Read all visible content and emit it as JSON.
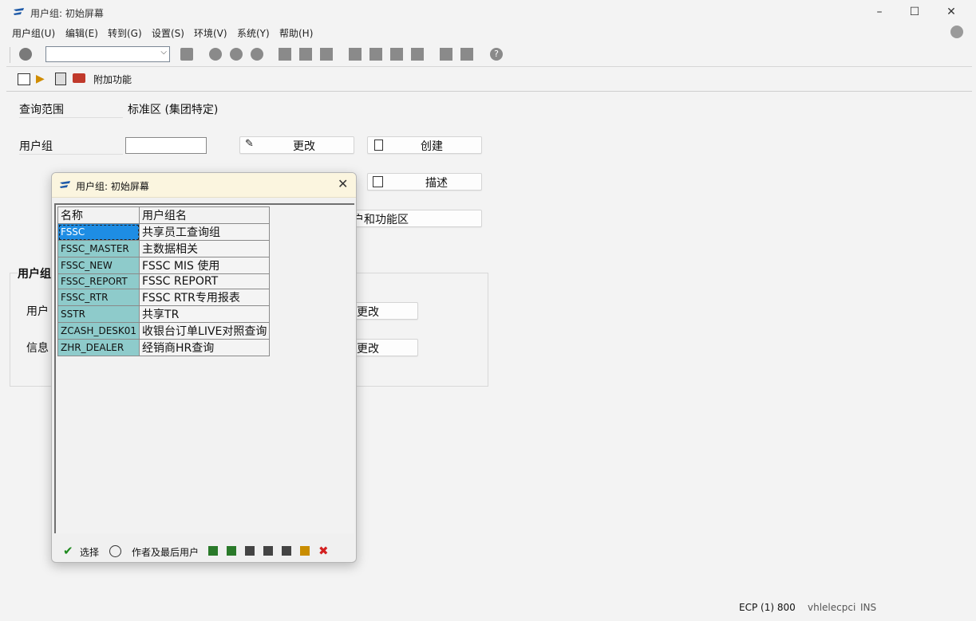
{
  "window": {
    "title": "用户组: 初始屏幕"
  },
  "menu": {
    "items": [
      "用户组(U)",
      "编辑(E)",
      "转到(G)",
      "设置(S)",
      "环境(V)",
      "系统(Y)",
      "帮助(H)"
    ]
  },
  "toolbar2": {
    "extra_label": "附加功能"
  },
  "main": {
    "scope_label": "查询范围",
    "scope_value": "标准区 (集团特定)",
    "group_label": "用户组",
    "group_value": "",
    "change_label": "更改",
    "create_label": "创建",
    "describe_label": "描述",
    "area_partial": "户和功能区",
    "section_partial": "用户组",
    "row_user_partial": "用户",
    "row_info_partial": "信息",
    "change2_label": "更改",
    "change3_label": "更改"
  },
  "dialog": {
    "title": "用户组: 初始屏幕",
    "columns": [
      "名称",
      "用户组名"
    ],
    "rows": [
      {
        "name": "FSSC",
        "desc": "共享员工查询组",
        "selected": true
      },
      {
        "name": "FSSC_MASTER",
        "desc": "主数据相关"
      },
      {
        "name": "FSSC_NEW",
        "desc": "FSSC MIS 使用"
      },
      {
        "name": "FSSC_REPORT",
        "desc": "FSSC REPORT"
      },
      {
        "name": "FSSC_RTR",
        "desc": "FSSC RTR专用报表"
      },
      {
        "name": "SSTR",
        "desc": "共享TR"
      },
      {
        "name": "ZCASH_DESK01",
        "desc": "收银台订单LIVE对照查询"
      },
      {
        "name": "ZHR_DEALER",
        "desc": "经销商HR查询"
      }
    ],
    "select_label": "选择",
    "author_label": "作者及最后用户"
  },
  "statusbar": {
    "system": "ECP (1) 800",
    "server": "vhlelecpci",
    "mode": "INS"
  },
  "colors": {
    "selected_cell": "#1e8de4",
    "key_cell": "#8ecbcb",
    "dialog_header": "#fbf5df"
  }
}
